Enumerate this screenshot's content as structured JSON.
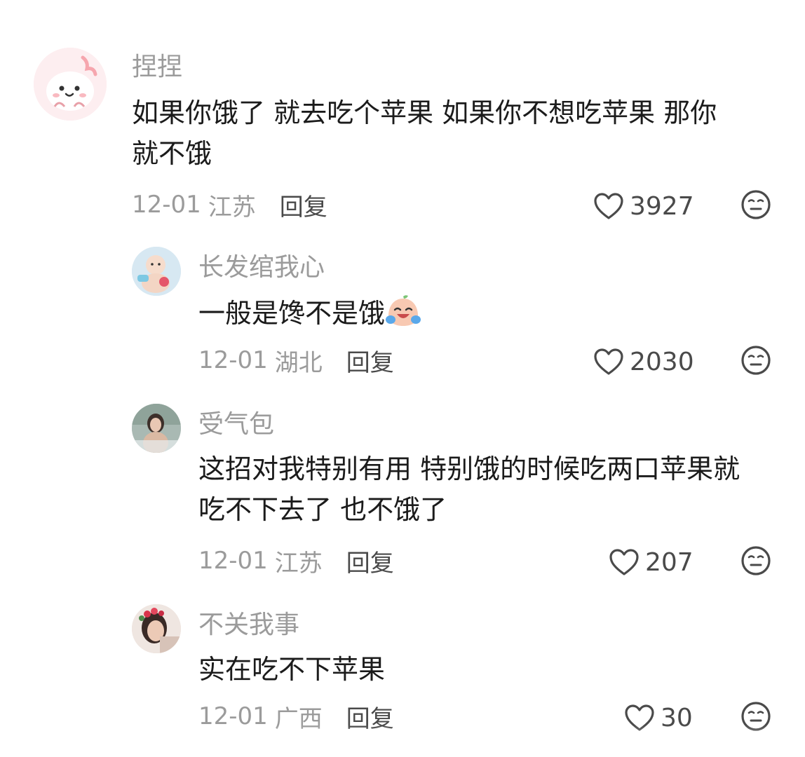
{
  "comments": [
    {
      "username": "捏捏",
      "text": "如果你饿了 就去吃个苹果 如果你不想吃苹果 那你\n就不饿",
      "date": "12-01",
      "location": "江苏",
      "reply_label": "回复",
      "likes": "3927"
    },
    {
      "username": "长发绾我心",
      "text": "一般是馋不是饿",
      "date": "12-01",
      "location": "湖北",
      "reply_label": "回复",
      "likes": "2030"
    },
    {
      "username": "受气包",
      "text": "这招对我特别有用 特别饿的时候吃两口苹果就\n吃不下去了 也不饿了",
      "date": "12-01",
      "location": "江苏",
      "reply_label": "回复",
      "likes": "207"
    },
    {
      "username": "不关我事",
      "text": "实在吃不下苹果",
      "date": "12-01",
      "location": "广西",
      "reply_label": "回复",
      "likes": "30"
    }
  ],
  "icons": {
    "like": "heart-outline-icon",
    "dislike": "neutral-face-icon",
    "inline_emoji": "laughing-crying-emoji"
  },
  "colors": {
    "username": "#9b9b9b",
    "text": "#1b1b1b",
    "meta": "#9b9b9b",
    "reply": "#4a4a4a"
  }
}
